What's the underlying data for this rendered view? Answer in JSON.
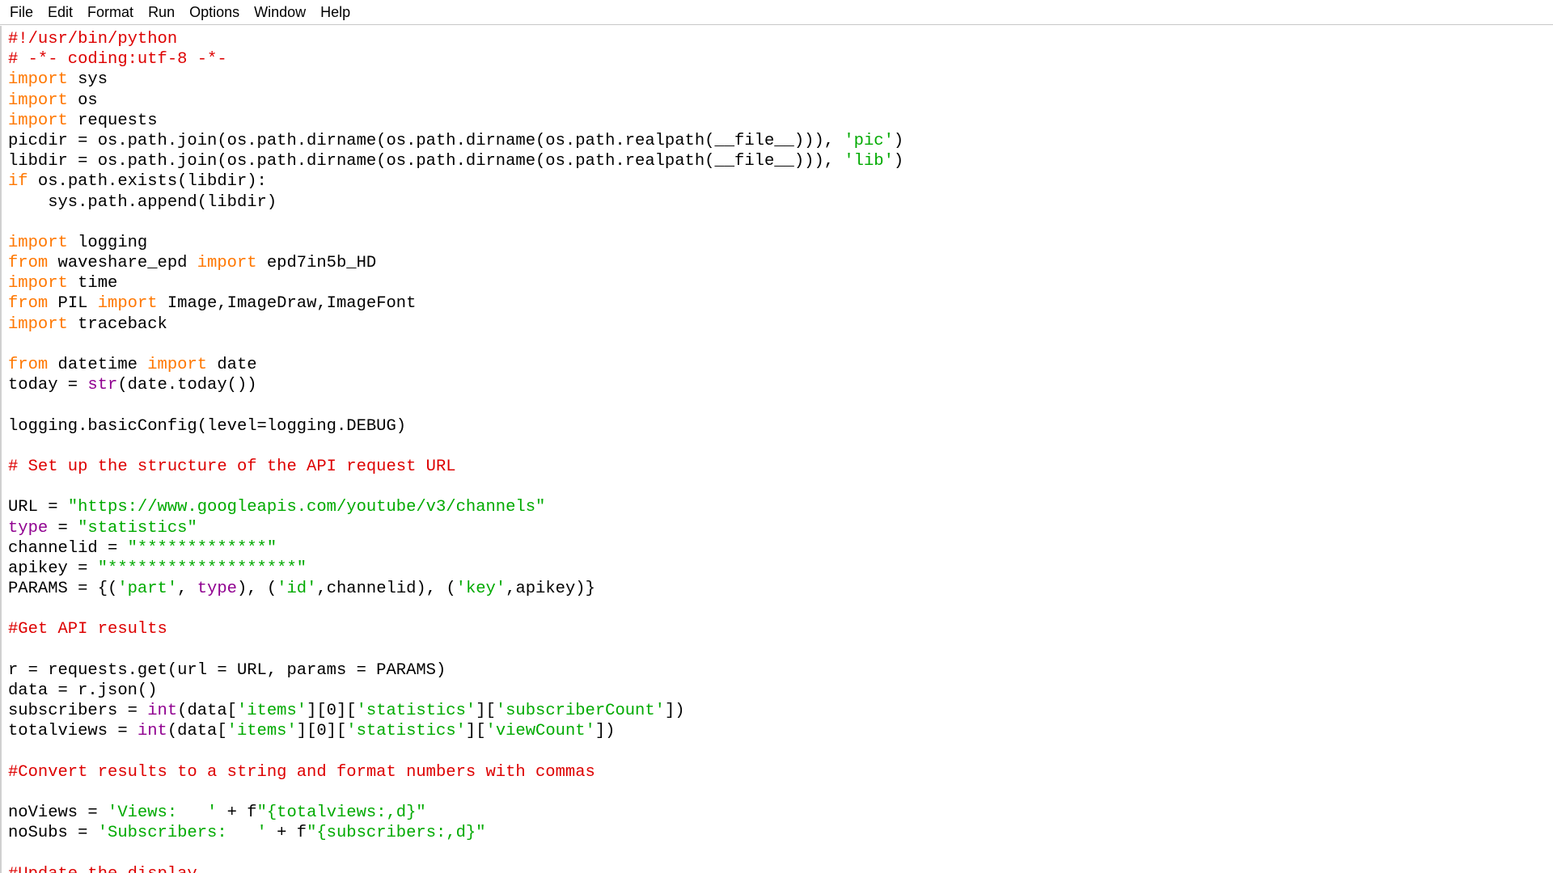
{
  "menu": {
    "items": [
      "File",
      "Edit",
      "Format",
      "Run",
      "Options",
      "Window",
      "Help"
    ]
  },
  "editor": {
    "lines": [
      [
        {
          "t": "#!/usr/bin/python",
          "c": "cm"
        }
      ],
      [
        {
          "t": "# -*- coding:utf-8 -*-",
          "c": "cm"
        }
      ],
      [
        {
          "t": "import",
          "c": "kw"
        },
        {
          "t": " sys",
          "c": "pl"
        }
      ],
      [
        {
          "t": "import",
          "c": "kw"
        },
        {
          "t": " os",
          "c": "pl"
        }
      ],
      [
        {
          "t": "import",
          "c": "kw"
        },
        {
          "t": " requests",
          "c": "pl"
        }
      ],
      [
        {
          "t": "picdir = os.path.join(os.path.dirname(os.path.dirname(os.path.realpath(__file__))), ",
          "c": "pl"
        },
        {
          "t": "'pic'",
          "c": "str"
        },
        {
          "t": ")",
          "c": "pl"
        }
      ],
      [
        {
          "t": "libdir = os.path.join(os.path.dirname(os.path.dirname(os.path.realpath(__file__))), ",
          "c": "pl"
        },
        {
          "t": "'lib'",
          "c": "str"
        },
        {
          "t": ")",
          "c": "pl"
        }
      ],
      [
        {
          "t": "if",
          "c": "kw"
        },
        {
          "t": " os.path.exists(libdir):",
          "c": "pl"
        }
      ],
      [
        {
          "t": "    sys.path.append(libdir)",
          "c": "pl"
        }
      ],
      [],
      [
        {
          "t": "import",
          "c": "kw"
        },
        {
          "t": " logging",
          "c": "pl"
        }
      ],
      [
        {
          "t": "from",
          "c": "kw"
        },
        {
          "t": " waveshare_epd ",
          "c": "pl"
        },
        {
          "t": "import",
          "c": "kw"
        },
        {
          "t": " epd7in5b_HD",
          "c": "pl"
        }
      ],
      [
        {
          "t": "import",
          "c": "kw"
        },
        {
          "t": " time",
          "c": "pl"
        }
      ],
      [
        {
          "t": "from",
          "c": "kw"
        },
        {
          "t": " PIL ",
          "c": "pl"
        },
        {
          "t": "import",
          "c": "kw"
        },
        {
          "t": " Image,ImageDraw,ImageFont",
          "c": "pl"
        }
      ],
      [
        {
          "t": "import",
          "c": "kw"
        },
        {
          "t": " traceback",
          "c": "pl"
        }
      ],
      [],
      [
        {
          "t": "from",
          "c": "kw"
        },
        {
          "t": " datetime ",
          "c": "pl"
        },
        {
          "t": "import",
          "c": "kw"
        },
        {
          "t": " date",
          "c": "pl"
        }
      ],
      [
        {
          "t": "today = ",
          "c": "pl"
        },
        {
          "t": "str",
          "c": "bi"
        },
        {
          "t": "(date.today())",
          "c": "pl"
        }
      ],
      [],
      [
        {
          "t": "logging.basicConfig(level=logging.DEBUG)",
          "c": "pl"
        }
      ],
      [],
      [
        {
          "t": "# Set up the structure of the API request URL",
          "c": "cm"
        }
      ],
      [],
      [
        {
          "t": "URL = ",
          "c": "pl"
        },
        {
          "t": "\"https://www.googleapis.com/youtube/v3/channels\"",
          "c": "str"
        }
      ],
      [
        {
          "t": "type",
          "c": "bi"
        },
        {
          "t": " = ",
          "c": "pl"
        },
        {
          "t": "\"statistics\"",
          "c": "str"
        }
      ],
      [
        {
          "t": "channelid = ",
          "c": "pl"
        },
        {
          "t": "\"*************\"",
          "c": "str"
        }
      ],
      [
        {
          "t": "apikey = ",
          "c": "pl"
        },
        {
          "t": "\"*******************\"",
          "c": "str"
        }
      ],
      [
        {
          "t": "PARAMS = {(",
          "c": "pl"
        },
        {
          "t": "'part'",
          "c": "str"
        },
        {
          "t": ", ",
          "c": "pl"
        },
        {
          "t": "type",
          "c": "bi"
        },
        {
          "t": "), (",
          "c": "pl"
        },
        {
          "t": "'id'",
          "c": "str"
        },
        {
          "t": ",channelid), (",
          "c": "pl"
        },
        {
          "t": "'key'",
          "c": "str"
        },
        {
          "t": ",apikey)}",
          "c": "pl"
        }
      ],
      [],
      [
        {
          "t": "#Get API results",
          "c": "cm"
        }
      ],
      [],
      [
        {
          "t": "r = requests.get(url = URL, params = PARAMS)",
          "c": "pl"
        }
      ],
      [
        {
          "t": "data = r.json()",
          "c": "pl"
        }
      ],
      [
        {
          "t": "subscribers = ",
          "c": "pl"
        },
        {
          "t": "int",
          "c": "bi"
        },
        {
          "t": "(data[",
          "c": "pl"
        },
        {
          "t": "'items'",
          "c": "str"
        },
        {
          "t": "][0][",
          "c": "pl"
        },
        {
          "t": "'statistics'",
          "c": "str"
        },
        {
          "t": "][",
          "c": "pl"
        },
        {
          "t": "'subscriberCount'",
          "c": "str"
        },
        {
          "t": "])",
          "c": "pl"
        }
      ],
      [
        {
          "t": "totalviews = ",
          "c": "pl"
        },
        {
          "t": "int",
          "c": "bi"
        },
        {
          "t": "(data[",
          "c": "pl"
        },
        {
          "t": "'items'",
          "c": "str"
        },
        {
          "t": "][0][",
          "c": "pl"
        },
        {
          "t": "'statistics'",
          "c": "str"
        },
        {
          "t": "][",
          "c": "pl"
        },
        {
          "t": "'viewCount'",
          "c": "str"
        },
        {
          "t": "])",
          "c": "pl"
        }
      ],
      [],
      [
        {
          "t": "#Convert results to a string and format numbers with commas",
          "c": "cm"
        }
      ],
      [],
      [
        {
          "t": "noViews = ",
          "c": "pl"
        },
        {
          "t": "'Views:   '",
          "c": "str"
        },
        {
          "t": " + f",
          "c": "pl"
        },
        {
          "t": "\"{totalviews:,d}\"",
          "c": "str"
        }
      ],
      [
        {
          "t": "noSubs = ",
          "c": "pl"
        },
        {
          "t": "'Subscribers:   '",
          "c": "str"
        },
        {
          "t": " + f",
          "c": "pl"
        },
        {
          "t": "\"{subscribers:,d}\"",
          "c": "str"
        }
      ],
      [],
      [
        {
          "t": "#Update the display",
          "c": "cm"
        }
      ]
    ]
  }
}
